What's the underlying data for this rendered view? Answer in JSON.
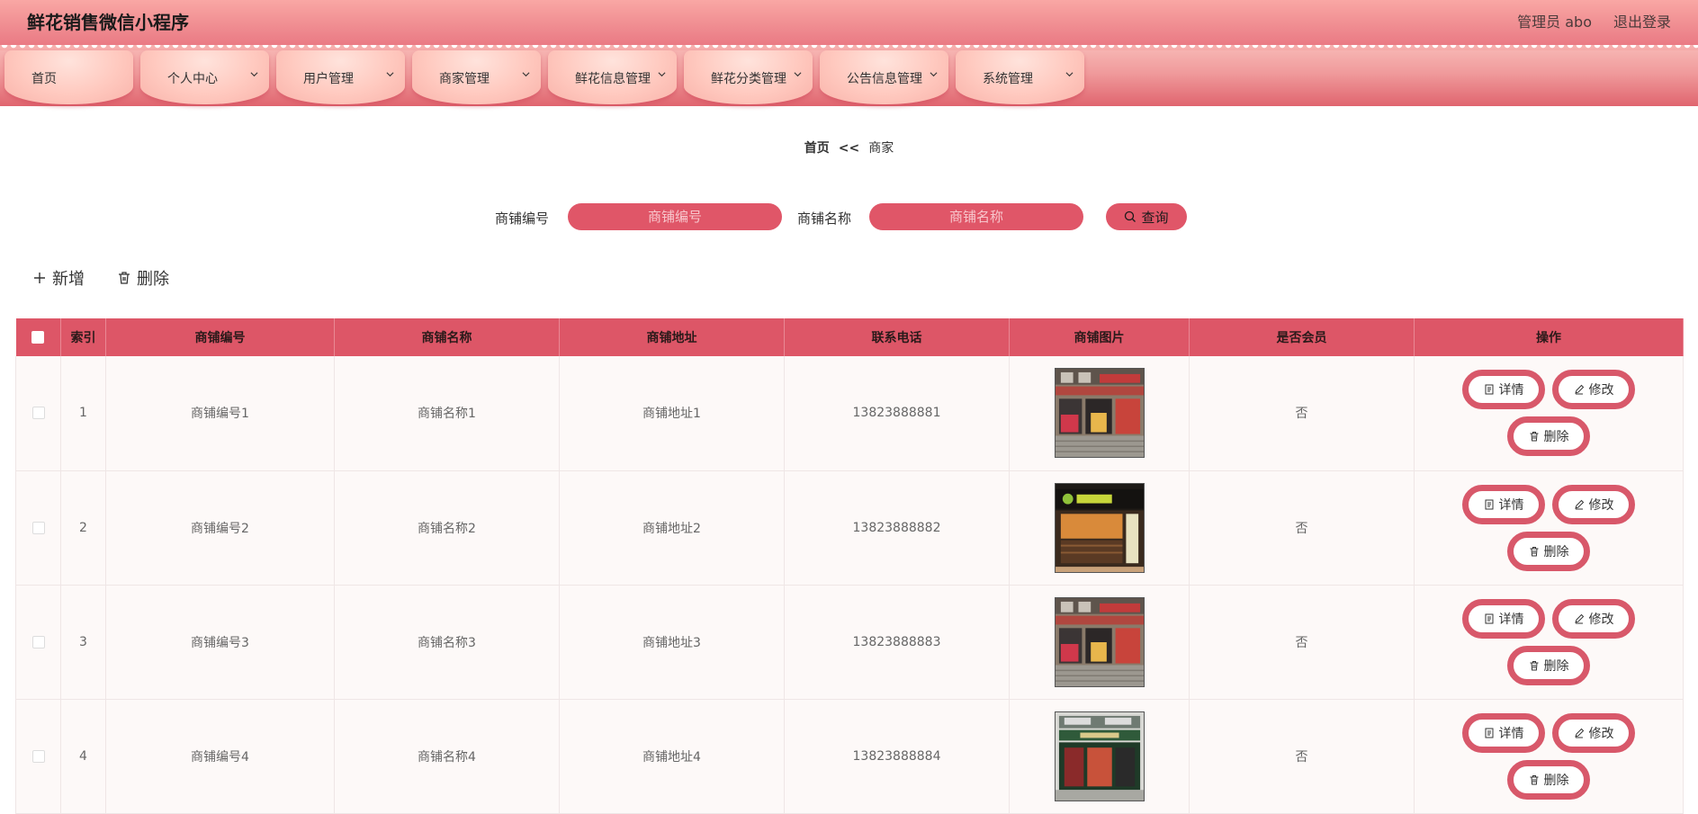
{
  "header": {
    "title": "鲜花销售微信小程序",
    "user_label": "管理员 abo",
    "logout_label": "退出登录"
  },
  "nav": {
    "items": [
      {
        "label": "首页",
        "has_dropdown": false
      },
      {
        "label": "个人中心",
        "has_dropdown": true
      },
      {
        "label": "用户管理",
        "has_dropdown": true
      },
      {
        "label": "商家管理",
        "has_dropdown": true
      },
      {
        "label": "鲜花信息管理",
        "has_dropdown": true
      },
      {
        "label": "鲜花分类管理",
        "has_dropdown": true
      },
      {
        "label": "公告信息管理",
        "has_dropdown": true
      },
      {
        "label": "系统管理",
        "has_dropdown": true
      }
    ]
  },
  "breadcrumb": {
    "home": "首页",
    "separator": "<<",
    "current": "商家"
  },
  "search": {
    "field1_label": "商铺编号",
    "field1_placeholder": "商铺编号",
    "field2_label": "商铺名称",
    "field2_placeholder": "商铺名称",
    "button_label": "查询"
  },
  "toolbar": {
    "add_label": "新增",
    "delete_label": "删除"
  },
  "table": {
    "columns": [
      "索引",
      "商铺编号",
      "商铺名称",
      "商铺地址",
      "联系电话",
      "商铺图片",
      "是否会员",
      "操作"
    ],
    "rows": [
      {
        "index": "1",
        "shop_no": "商铺编号1",
        "shop_name": "商铺名称1",
        "address": "商铺地址1",
        "phone": "13823888881",
        "image": "storefront-photo",
        "member": "否"
      },
      {
        "index": "2",
        "shop_no": "商铺编号2",
        "shop_name": "商铺名称2",
        "address": "商铺地址2",
        "phone": "13823888882",
        "image": "storefront-photo",
        "member": "否"
      },
      {
        "index": "3",
        "shop_no": "商铺编号3",
        "shop_name": "商铺名称3",
        "address": "商铺地址3",
        "phone": "13823888883",
        "image": "storefront-photo",
        "member": "否"
      },
      {
        "index": "4",
        "shop_no": "商铺编号4",
        "shop_name": "商铺名称4",
        "address": "商铺地址4",
        "phone": "13823888884",
        "image": "storefront-photo",
        "member": "否"
      }
    ],
    "actions": {
      "detail_label": "详情",
      "edit_label": "修改",
      "delete_label": "删除"
    }
  },
  "colors": {
    "accent": "#dd5667",
    "header_top": "#f9a7a4",
    "nav_tab": "#ffc9bf"
  }
}
